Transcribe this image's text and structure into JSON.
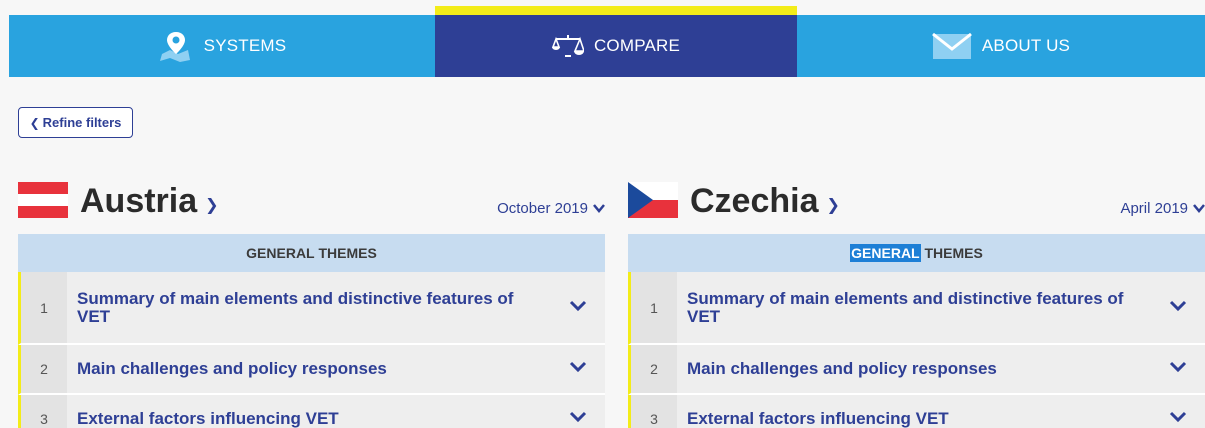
{
  "nav": {
    "systems_label": "SYSTEMS",
    "compare_label": "COMPARE",
    "about_label": "ABOUT US"
  },
  "refine": {
    "label": "Refine filters"
  },
  "left": {
    "country": "Austria",
    "date": "October 2019",
    "theme_header_a": "GENERAL",
    "theme_header_b": " THEMES",
    "rows": [
      {
        "num": "1",
        "title": "Summary of main elements and distinctive features of VET"
      },
      {
        "num": "2",
        "title": "Main challenges and policy responses"
      },
      {
        "num": "3",
        "title": "External factors influencing VET"
      }
    ]
  },
  "right": {
    "country": "Czechia",
    "date": "April 2019",
    "theme_header_a": "GENERAL",
    "theme_header_b": " THEMES",
    "rows": [
      {
        "num": "1",
        "title": "Summary of main elements and distinctive features of VET"
      },
      {
        "num": "2",
        "title": "Main challenges and policy responses"
      },
      {
        "num": "3",
        "title": "External factors influencing VET"
      }
    ]
  },
  "colors": {
    "nav_blue": "#29a3df",
    "nav_active": "#2e3f95",
    "active_bar": "#f3ec19",
    "theme_header_bg": "#c7dcf0"
  }
}
